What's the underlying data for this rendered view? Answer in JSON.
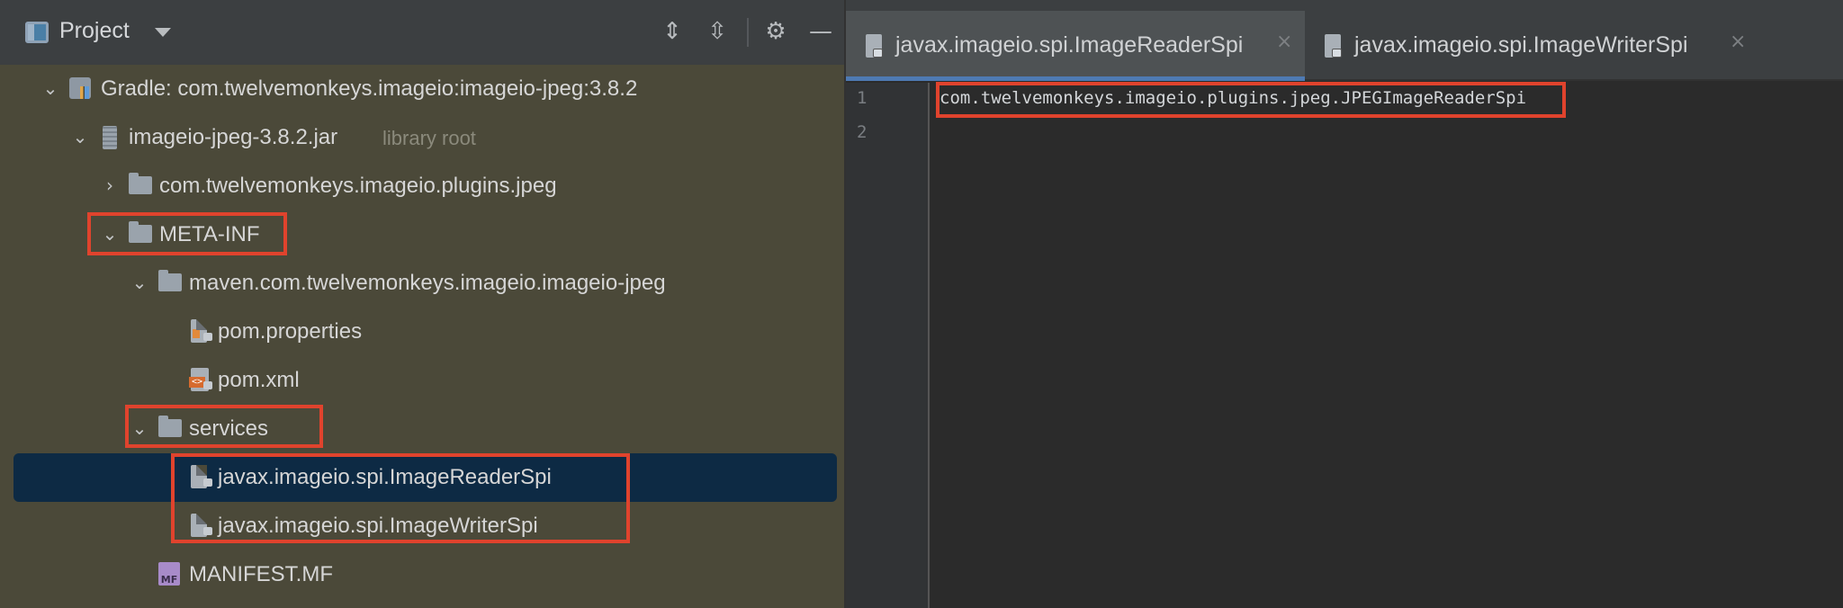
{
  "project_panel": {
    "title": "Project",
    "tree": [
      {
        "label": "Gradle: com.twelvemonkeys.imageio:imageio-jpeg:3.8.2"
      },
      {
        "label": "imageio-jpeg-3.8.2.jar",
        "hint": "library root"
      },
      {
        "label": "com.twelvemonkeys.imageio.plugins.jpeg"
      },
      {
        "label": "META-INF"
      },
      {
        "label": "maven.com.twelvemonkeys.imageio.imageio-jpeg"
      },
      {
        "label": "pom.properties"
      },
      {
        "label": "pom.xml"
      },
      {
        "label": "services"
      },
      {
        "label": "javax.imageio.spi.ImageReaderSpi"
      },
      {
        "label": "javax.imageio.spi.ImageWriterSpi"
      },
      {
        "label": "MANIFEST.MF"
      }
    ]
  },
  "editor": {
    "tabs": [
      {
        "label": "javax.imageio.spi.ImageReaderSpi"
      },
      {
        "label": "javax.imageio.spi.ImageWriterSpi"
      }
    ],
    "lines": [
      {
        "number": "1",
        "text": "com.twelvemonkeys.imageio.plugins.jpeg.JPEGImageReaderSpi"
      },
      {
        "number": "2",
        "text": ""
      }
    ]
  },
  "colors": {
    "highlight": "#e0432d",
    "selection": "#0d2a44",
    "tree_background": "#4b4939",
    "editor_background": "#2b2b2b"
  }
}
